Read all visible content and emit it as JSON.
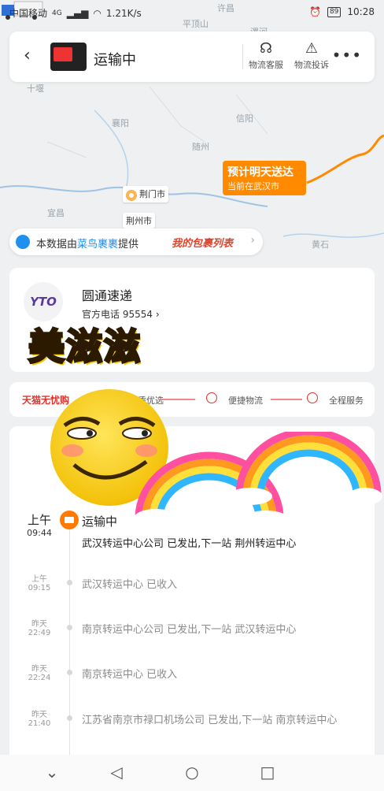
{
  "status_bar": {
    "carrier": "中国移动",
    "network": "4G",
    "speed": "1.21K/s",
    "battery": "89",
    "time": "10:28"
  },
  "header": {
    "title": "运输中",
    "support_label": "物流客服",
    "complaint_label": "物流投诉"
  },
  "map": {
    "place_labels": [
      "许昌",
      "平顶山",
      "漯河",
      "十堰",
      "襄阳",
      "信阳",
      "随州",
      "宜昌",
      "黄石"
    ],
    "eta_title": "预计明天送达",
    "eta_subtitle": "当前在武汉市",
    "city_tags": [
      "荆门市",
      "荆州市"
    ]
  },
  "data_source": {
    "prefix": "本数据由",
    "provider": "菜鸟裹裹",
    "suffix": "提供",
    "my_packages": "我的包裹列表"
  },
  "courier": {
    "logo_text": "YTO",
    "name": "圆通速递",
    "phone": "官方电话 95554"
  },
  "sticker_text": "美滋滋",
  "services": {
    "brand": "天猫无忧购",
    "items": [
      "品质优选",
      "便捷物流",
      "全程服务"
    ]
  },
  "timeline": {
    "current": {
      "day": "上午",
      "time": "09:44",
      "status": "运输中",
      "desc": "武汉转运中心公司 已发出,下一站 荆州转运中心"
    },
    "events": [
      {
        "day": "上午",
        "time": "09:15",
        "desc": "武汉转运中心 已收入"
      },
      {
        "day": "昨天",
        "time": "22:49",
        "desc": "南京转运中心公司 已发出,下一站 武汉转运中心"
      },
      {
        "day": "昨天",
        "time": "22:24",
        "desc": "南京转运中心 已收入"
      },
      {
        "day": "昨天",
        "time": "21:40",
        "desc": "江苏省南京市禄口机场公司 已发出,下一站 南京转运中心"
      }
    ]
  },
  "colors": {
    "accent_orange": "#ff8a00",
    "link_blue": "#1f8ff0",
    "tmall_red": "#e0332d"
  }
}
